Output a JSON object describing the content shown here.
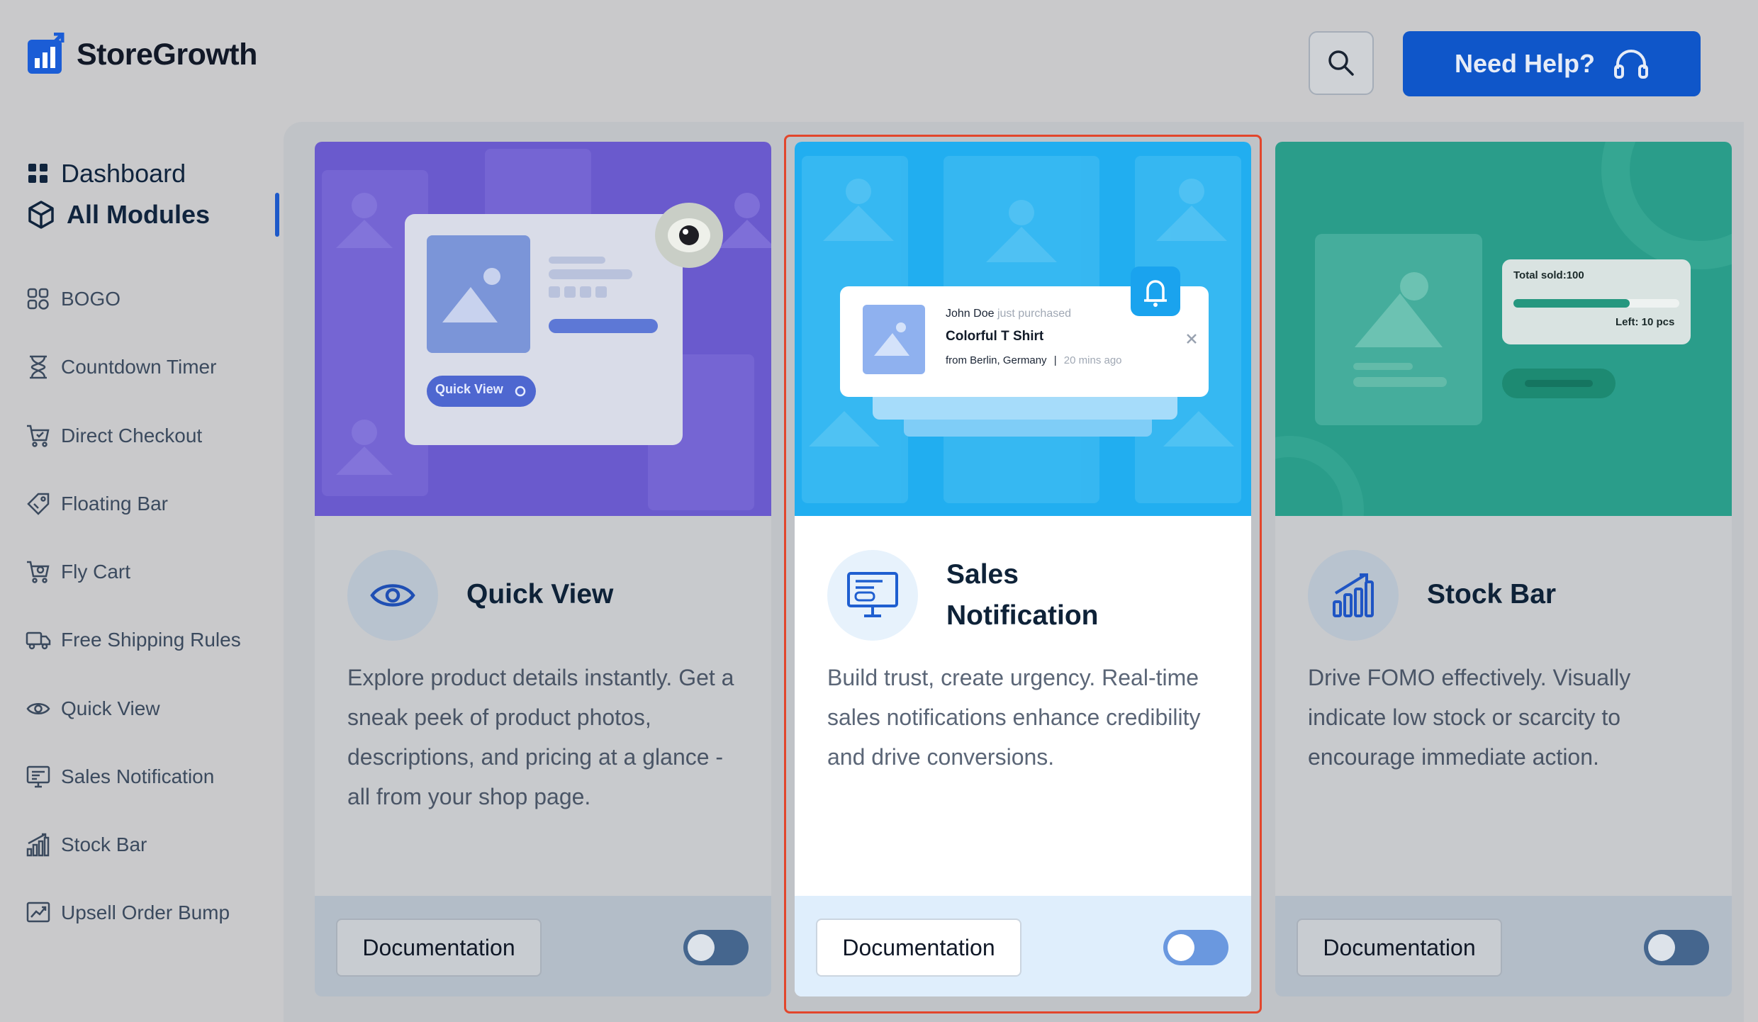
{
  "app": {
    "name": "StoreGrowth"
  },
  "header": {
    "help_label": "Need Help?"
  },
  "nav": {
    "dashboard": "Dashboard",
    "all_modules": "All Modules"
  },
  "sidebar": {
    "items": [
      {
        "label": "BOGO",
        "icon": "bogo-icon"
      },
      {
        "label": "Countdown Timer",
        "icon": "hourglass-icon"
      },
      {
        "label": "Direct Checkout",
        "icon": "cart-check-icon"
      },
      {
        "label": "Floating Bar",
        "icon": "tag-icon"
      },
      {
        "label": "Fly Cart",
        "icon": "cart-icon"
      },
      {
        "label": "Free Shipping Rules",
        "icon": "truck-icon"
      },
      {
        "label": "Quick View",
        "icon": "eye-icon"
      },
      {
        "label": "Sales Notification",
        "icon": "monitor-icon"
      },
      {
        "label": "Stock Bar",
        "icon": "bar-chart-icon"
      },
      {
        "label": "Upsell Order Bump",
        "icon": "trend-chart-icon"
      }
    ]
  },
  "cards": [
    {
      "title": "Quick View",
      "description": "Explore product details instantly. Get a sneak peek of product photos, descriptions, and pricing at a glance - all from your shop page.",
      "doc_label": "Documentation",
      "hero": {
        "button": "Quick View"
      },
      "enabled": false
    },
    {
      "title_line1": "Sales",
      "title_line2": "Notification",
      "description": "Build trust, create urgency. Real-time sales notifications enhance credibility and drive conversions.",
      "doc_label": "Documentation",
      "hero": {
        "buyer": "John Doe",
        "action": "just purchased",
        "product": "Colorful T Shirt",
        "location": "from Berlin, Germany",
        "separator": "|",
        "time": "20 mins ago"
      },
      "enabled": false
    },
    {
      "title": "Stock Bar",
      "description": "Drive FOMO effectively. Visually indicate low stock or scarcity to encourage immediate action.",
      "doc_label": "Documentation",
      "hero": {
        "total_sold": "Total sold:100",
        "left": "Left: 10 pcs",
        "sold_fraction": 0.78
      },
      "enabled": false
    }
  ],
  "colors": {
    "primary": "#0f56c9",
    "highlight": "#e2462c",
    "quick_view_bg": "#6a5acd",
    "sales_bg": "#21aef0",
    "stock_bg": "#2a9d8a"
  }
}
